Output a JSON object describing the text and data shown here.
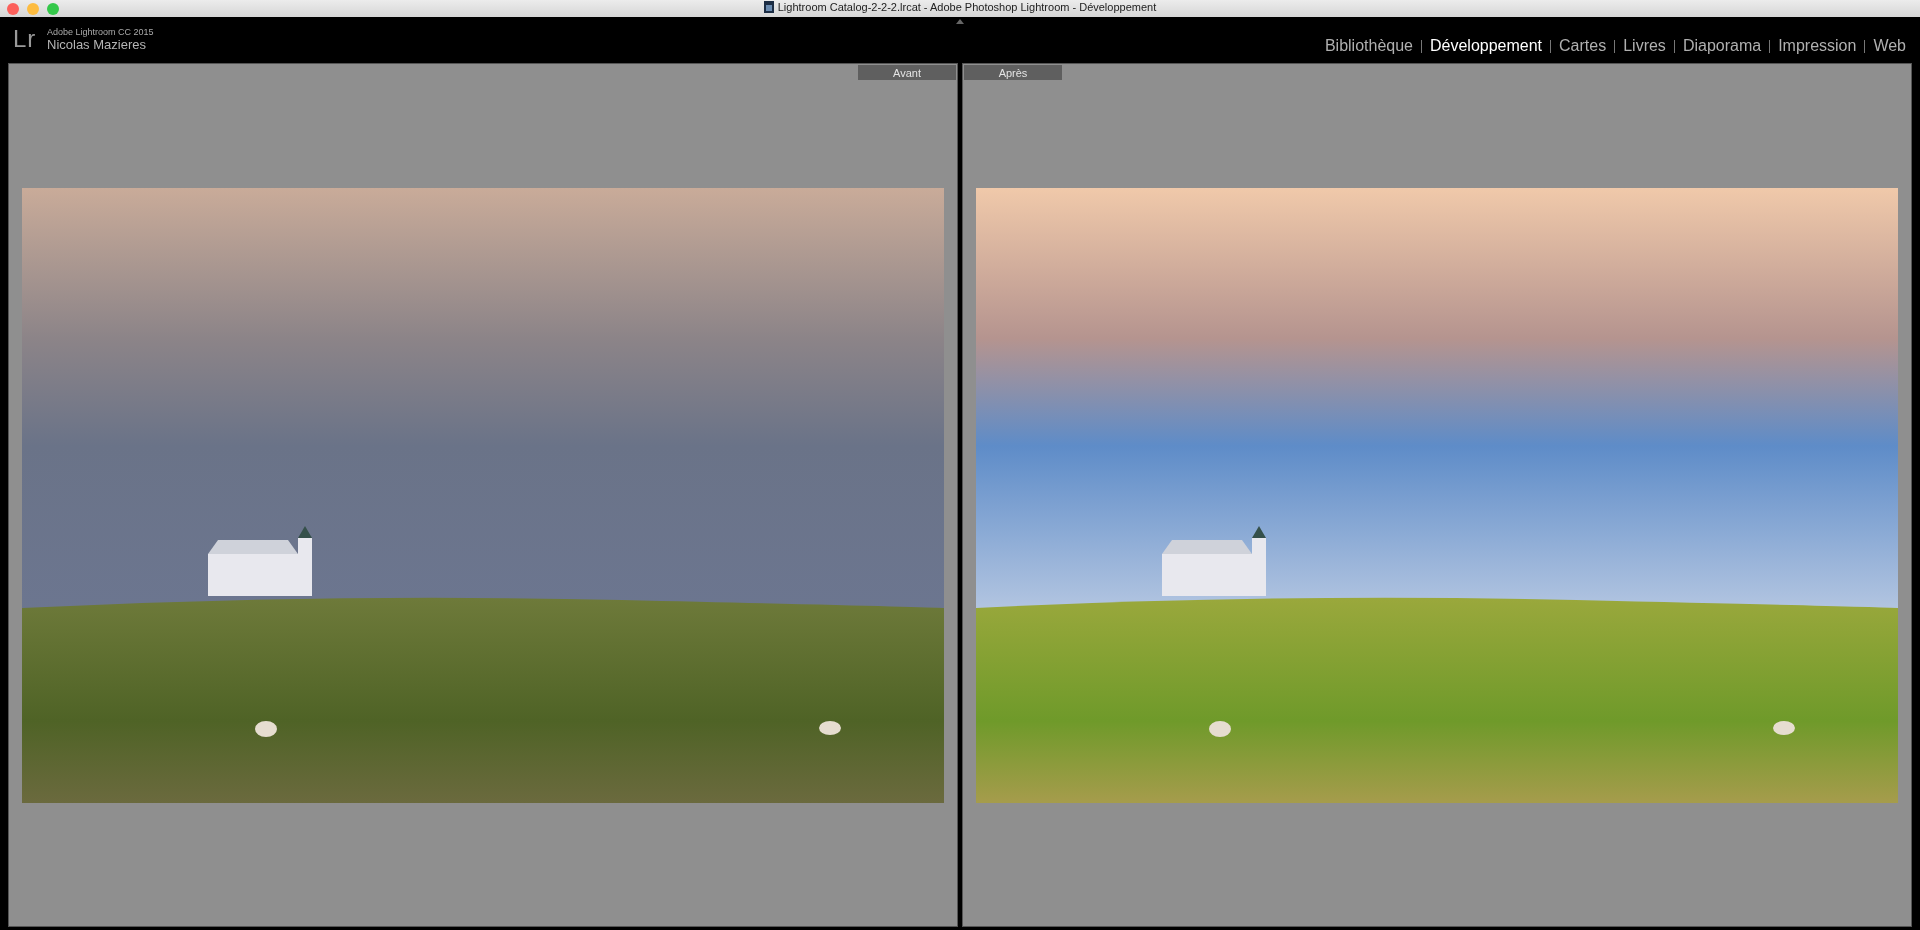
{
  "window": {
    "title": "Lightroom  Catalog-2-2-2.lrcat - Adobe Photoshop Lightroom - Développement"
  },
  "identity": {
    "logo": "Lr",
    "product": "Adobe Lightroom CC 2015",
    "user": "Nicolas Mazieres"
  },
  "modules": [
    {
      "label": "Bibliothèque",
      "selected": false
    },
    {
      "label": "Développement",
      "selected": true
    },
    {
      "label": "Cartes",
      "selected": false
    },
    {
      "label": "Livres",
      "selected": false
    },
    {
      "label": "Diaporama",
      "selected": false
    },
    {
      "label": "Impression",
      "selected": false
    },
    {
      "label": "Web",
      "selected": false
    }
  ],
  "compare": [
    {
      "label": "Avant",
      "kind": "before"
    },
    {
      "label": "Après",
      "kind": "after"
    }
  ]
}
